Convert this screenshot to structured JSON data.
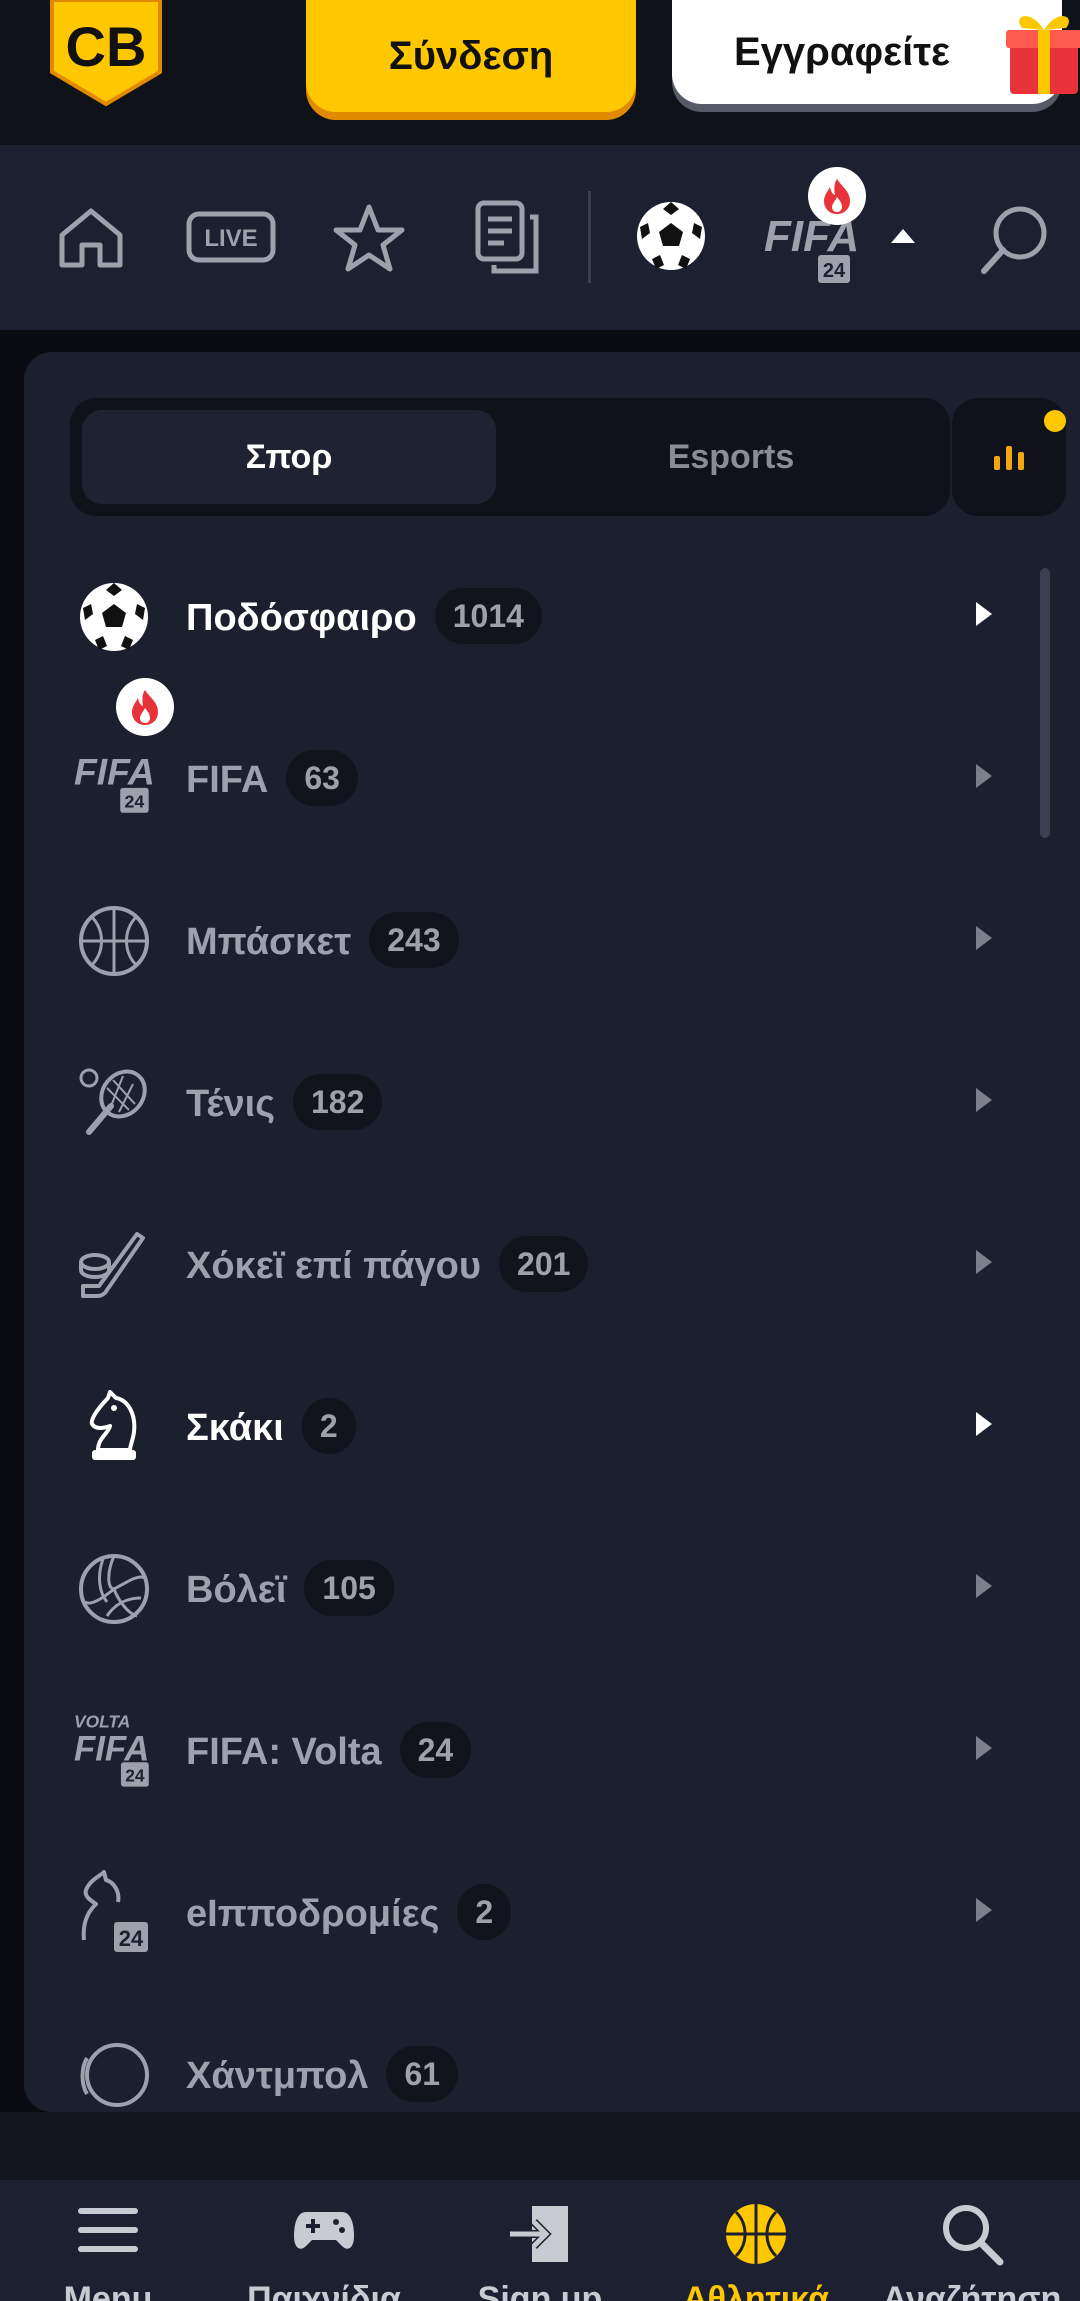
{
  "header": {
    "logo_text": "CB",
    "login_label": "Σύνδεση",
    "register_label": "Εγγραφείτε"
  },
  "sports_nav": {
    "items": [
      "home-icon",
      "live-icon",
      "star-icon",
      "betslip-icon",
      "soccer-ball-icon",
      "fifa-icon",
      "search-icon"
    ],
    "live_label": "LIVE",
    "fifa_label": "FIFA",
    "fifa_year": "24"
  },
  "panel": {
    "tabs": [
      {
        "label": "Σπορ",
        "active": true
      },
      {
        "label": "Esports",
        "active": false
      }
    ],
    "sports": [
      {
        "name": "Ποδόσφαιρο",
        "count": "1014",
        "icon": "soccer-ball-icon",
        "bright": true
      },
      {
        "name": "FIFA",
        "count": "63",
        "icon": "fifa-icon",
        "bright": false,
        "hot": true
      },
      {
        "name": "Μπάσκετ",
        "count": "243",
        "icon": "basketball-icon",
        "bright": false
      },
      {
        "name": "Τένις",
        "count": "182",
        "icon": "tennis-icon",
        "bright": false
      },
      {
        "name": "Χόκεϊ επί πάγου",
        "count": "201",
        "icon": "hockey-icon",
        "bright": false
      },
      {
        "name": "Σκάκι",
        "count": "2",
        "icon": "chess-knight-icon",
        "bright": true
      },
      {
        "name": "Βόλεϊ",
        "count": "105",
        "icon": "volleyball-icon",
        "bright": false
      },
      {
        "name": "FIFA: Volta",
        "count": "24",
        "icon": "fifa-volta-icon",
        "bright": false
      },
      {
        "name": "eΙπποδρομίες",
        "count": "2",
        "icon": "horse-racing-icon",
        "bright": false
      },
      {
        "name": "Χάντμπολ",
        "count": "61",
        "icon": "handball-icon",
        "bright": false
      }
    ]
  },
  "bottom_nav": {
    "tabs": [
      {
        "label": "Menu",
        "icon": "hamburger-icon",
        "active": false
      },
      {
        "label": "Παιχνίδια",
        "icon": "gamepad-icon",
        "active": false
      },
      {
        "label": "Sign up",
        "icon": "sign-in-icon",
        "active": false
      },
      {
        "label": "Αθλητικά",
        "icon": "basketball-icon",
        "active": true
      },
      {
        "label": "Αναζήτηση",
        "icon": "search-icon",
        "active": false
      }
    ]
  },
  "colors": {
    "accent": "#ffc700",
    "panel_bg": "#1c1f2e",
    "nav_bg": "#1d2030",
    "hot_red": "#e8333b"
  }
}
